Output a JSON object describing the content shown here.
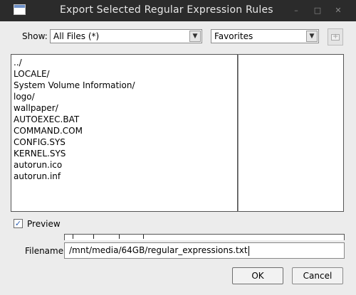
{
  "window": {
    "title": "Export Selected Regular Expression Rules",
    "app_icon": "window-icon",
    "controls": {
      "minimize": "–",
      "maximize": "□",
      "close": "✕"
    }
  },
  "toolbar": {
    "show_label": "Show:",
    "filter_value": "All Files (*)",
    "favorites_value": "Favorites",
    "new_folder_icon": "new-folder-icon"
  },
  "files": [
    "../",
    "LOCALE/",
    "System Volume Information/",
    "logo/",
    "wallpaper/",
    "AUTOEXEC.BAT",
    "COMMAND.COM",
    "CONFIG.SYS",
    "KERNEL.SYS",
    "autorun.ico",
    "autorun.inf"
  ],
  "preview": {
    "label": "Preview",
    "checked": true,
    "check_glyph": "✓"
  },
  "filename": {
    "label": "Filename:",
    "value": "/mnt/media/64GB/regular_expressions.txt"
  },
  "buttons": {
    "ok": "OK",
    "cancel": "Cancel"
  },
  "colors": {
    "titlebar": "#2b2b2b",
    "background": "#ececec",
    "accent": "#2a5db0"
  }
}
